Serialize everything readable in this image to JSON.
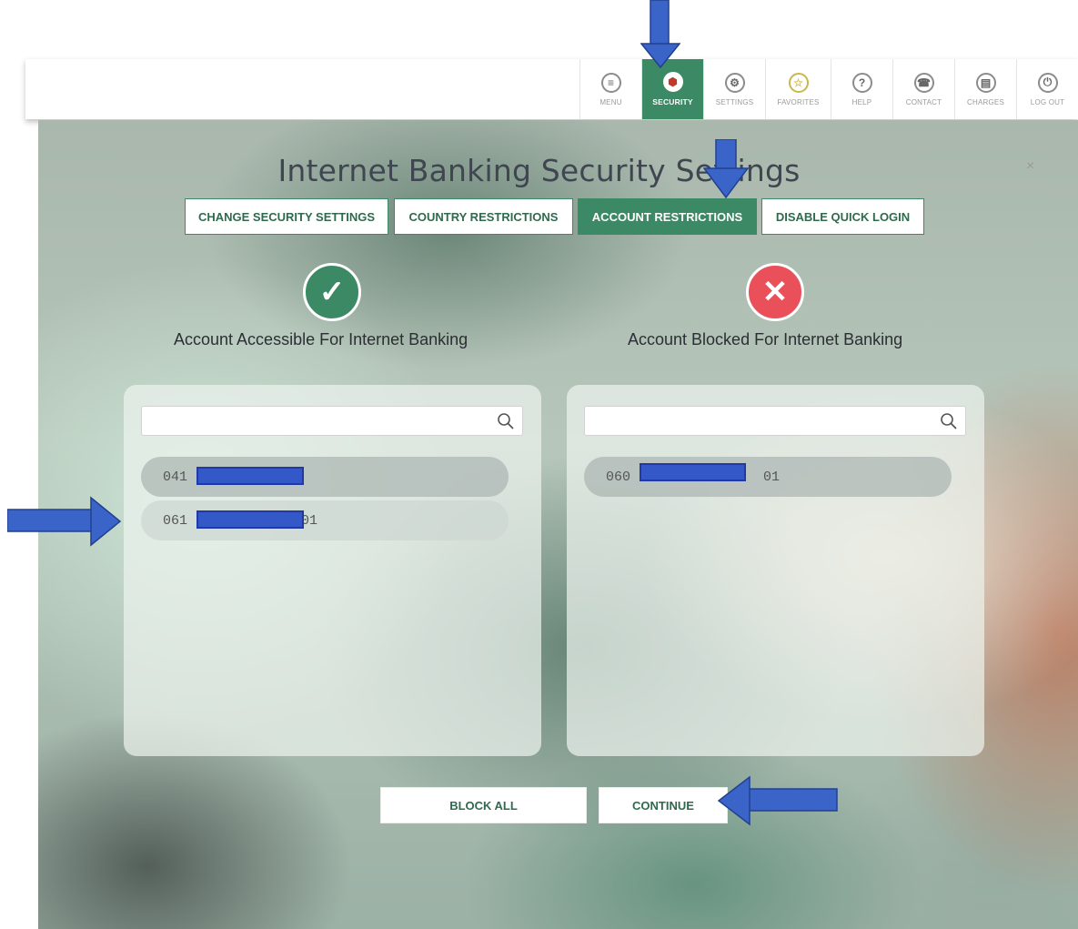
{
  "nav": {
    "items": [
      {
        "label": "MENU",
        "icon": "≡"
      },
      {
        "label": "SECURITY",
        "icon": "⬢"
      },
      {
        "label": "SETTINGS",
        "icon": "⚙"
      },
      {
        "label": "FAVORITES",
        "icon": "☆"
      },
      {
        "label": "HELP",
        "icon": "?"
      },
      {
        "label": "CONTACT",
        "icon": "☎"
      },
      {
        "label": "CHARGES",
        "icon": "▤"
      },
      {
        "label": "LOG OUT",
        "icon": "⏻"
      }
    ],
    "active": "SECURITY"
  },
  "page": {
    "title": "Internet Banking Security Settings",
    "close": "×"
  },
  "tabs": [
    {
      "label": "CHANGE SECURITY SETTINGS"
    },
    {
      "label": "COUNTRY RESTRICTIONS"
    },
    {
      "label": "ACCOUNT RESTRICTIONS"
    },
    {
      "label": "DISABLE QUICK LOGIN"
    }
  ],
  "columns": {
    "accessible": {
      "title": "Account Accessible For Internet Banking",
      "icon": "✓",
      "search_placeholder": "",
      "accounts": [
        "041",
        "061",
        "01"
      ]
    },
    "blocked": {
      "title": "Account Blocked For Internet Banking",
      "icon": "✕",
      "search_placeholder": "",
      "accounts": [
        "060",
        "01"
      ]
    }
  },
  "actions": {
    "block_all": "BLOCK ALL",
    "continue": "CONTINUE"
  },
  "colors": {
    "brand_green": "#3c8a65",
    "blocked_red": "#e9505a",
    "annotation_blue": "#3a64c8"
  }
}
